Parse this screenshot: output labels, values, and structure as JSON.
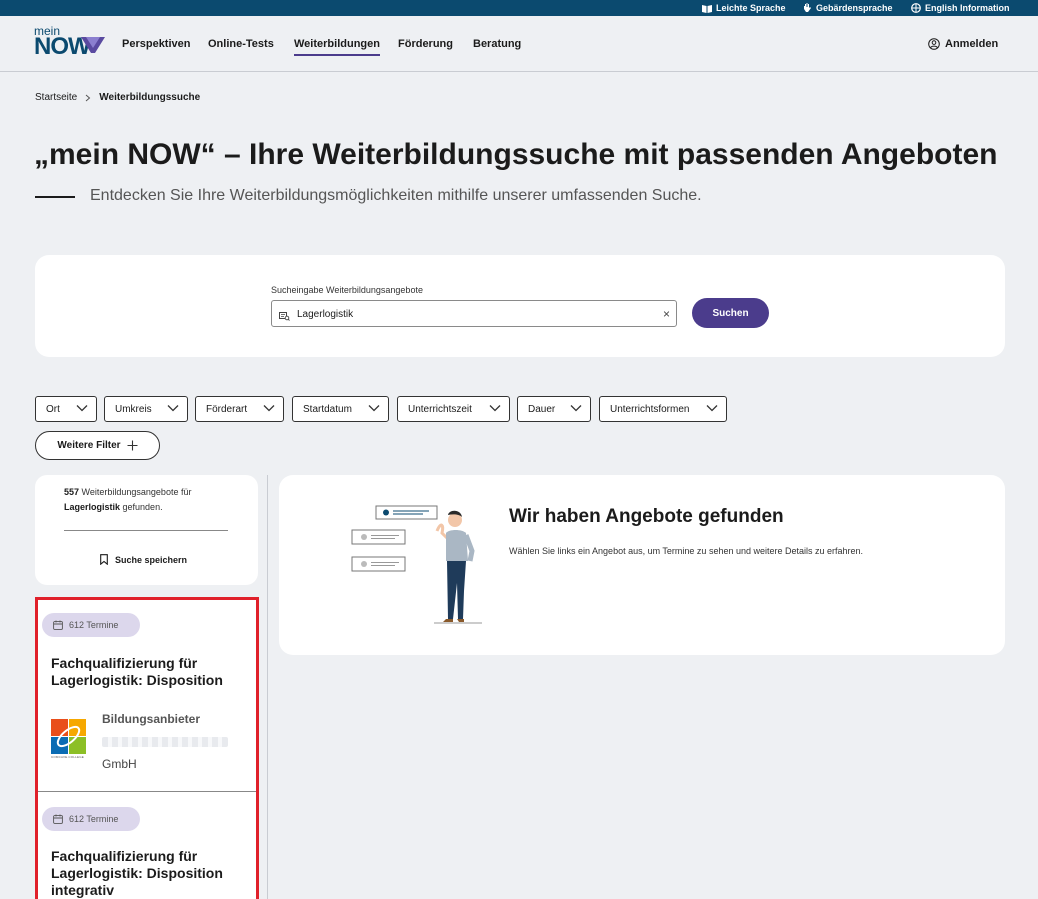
{
  "topbar": {
    "easy_language": "Leichte Sprache",
    "sign_language": "Gebärdensprache",
    "english": "English Information"
  },
  "header": {
    "logo_small": "mein",
    "logo_big": "NOW",
    "nav": [
      "Perspektiven",
      "Online-Tests",
      "Weiterbildungen",
      "Förderung",
      "Beratung"
    ],
    "active_nav": "Weiterbildungen",
    "login": "Anmelden"
  },
  "breadcrumb": {
    "home": "Startseite",
    "current": "Weiterbildungssuche"
  },
  "page": {
    "title": "„mein NOW“ – Ihre Weiterbildungssuche mit passenden Angeboten",
    "subtitle": "Entdecken Sie Ihre Weiterbildungsmöglichkeiten mithilfe unserer umfassenden Suche."
  },
  "search": {
    "label": "Sucheingabe Weiterbildungsangebote",
    "value": "Lagerlogistik",
    "button": "Suchen"
  },
  "filters": [
    "Ort",
    "Umkreis",
    "Förderart",
    "Startdatum",
    "Unterrichtszeit",
    "Dauer",
    "Unterrichtsformen"
  ],
  "more_filters": "Weitere Filter",
  "results": {
    "count": "557",
    "count_text": "Weiterbildungsangebote für",
    "query": "Lagerlogistik",
    "found_suffix": "gefunden.",
    "save_search": "Suche speichern"
  },
  "offers": [
    {
      "dates": "612 Termine",
      "title": "Fachqualifizierung für Lagerlogistik: Disposition",
      "provider_label": "Bildungsanbieter",
      "provider_company": "GmbH",
      "logo_caption": "COMCAVE.COLLEGE"
    },
    {
      "dates": "612 Termine",
      "title": "Fachqualifizierung für Lagerlogistik: Disposition integrativ"
    }
  ],
  "found_panel": {
    "title": "Wir haben Angebote gefunden",
    "text": "Wählen Sie links ein Angebot aus, um Termine zu sehen und weitere Details zu erfahren."
  },
  "colors": {
    "topbar": "#0b4a6f",
    "brand": "#4b3c8c",
    "pill": "#dcd7ec",
    "highlight": "#e0202a"
  }
}
